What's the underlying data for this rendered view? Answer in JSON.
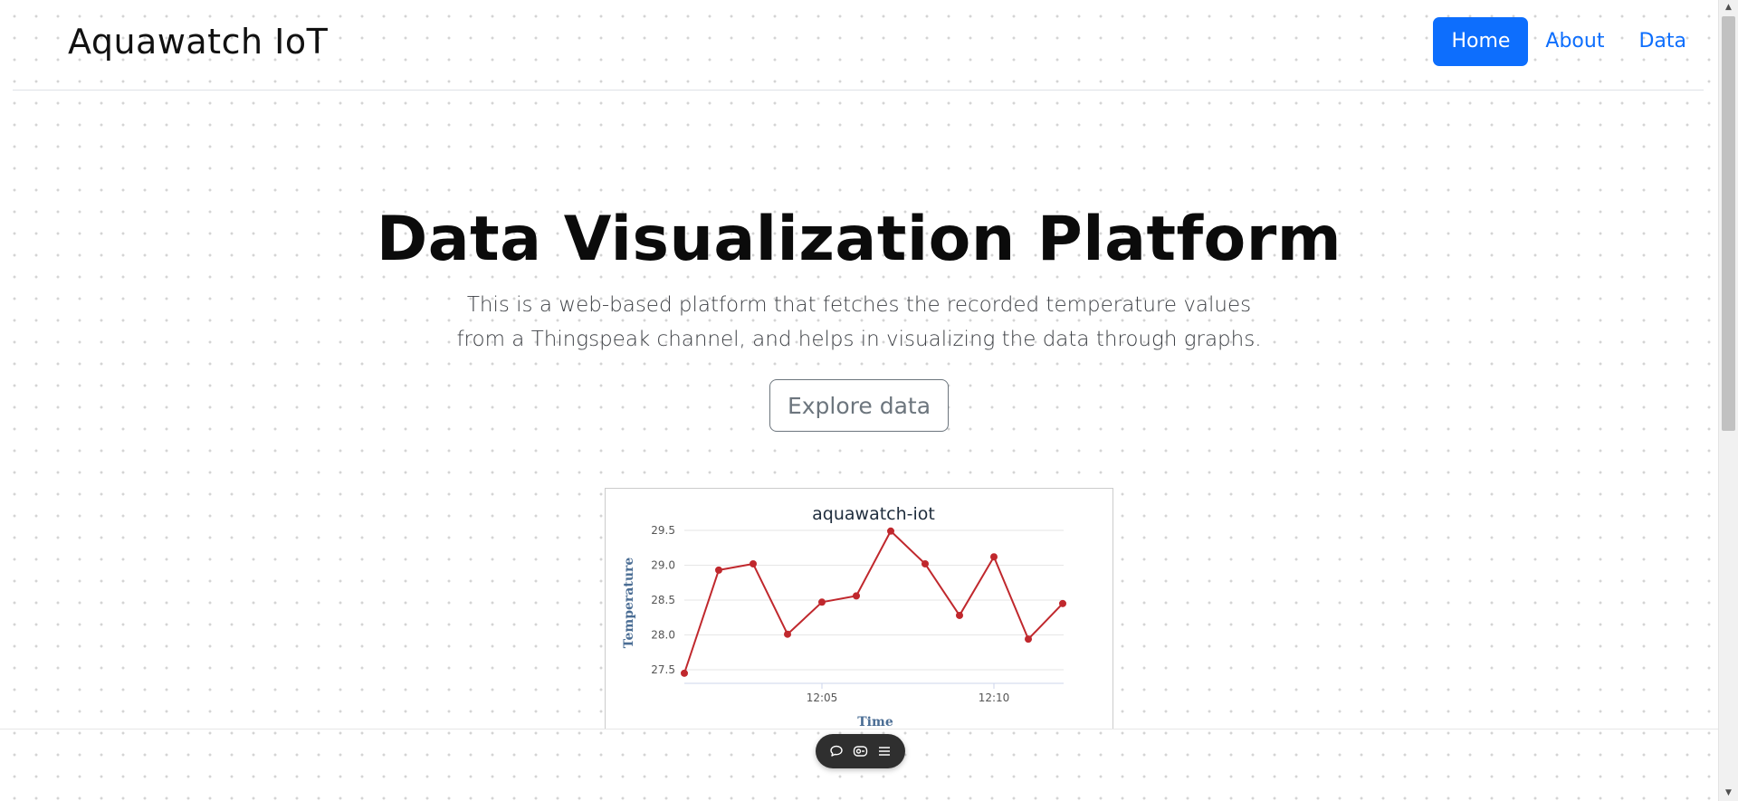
{
  "navbar": {
    "brand": "Aquawatch IoT",
    "links": [
      "Home",
      "About",
      "Data"
    ],
    "active_link": "Home",
    "accent_color": "#0d6efd"
  },
  "hero": {
    "title": "Data Visualization Platform",
    "lead": "This is a web-based platform that fetches the recorded temperature values from a Thingspeak channel, and helps in visualizing the data through graphs.",
    "explore_button": "Explore data"
  },
  "chart_data": {
    "type": "line",
    "title": "aquawatch-iot",
    "xlabel": "Time",
    "ylabel": "Temperature",
    "x": [
      "12:01",
      "12:02",
      "12:03",
      "12:04",
      "12:05",
      "12:06",
      "12:07",
      "12:08",
      "12:09",
      "12:10",
      "12:11",
      "12:12"
    ],
    "y": [
      27.45,
      28.93,
      29.02,
      28.01,
      28.47,
      28.56,
      29.49,
      29.02,
      28.28,
      29.12,
      27.94,
      28.45
    ],
    "x_ticks": [
      "12:05",
      "12:10"
    ],
    "y_ticks": [
      27.5,
      28.0,
      28.5,
      29.0,
      29.5
    ],
    "ylim": [
      27.5,
      29.5
    ],
    "line_color": "#c0282d",
    "grid": true,
    "legend": "none"
  },
  "toolbar": {
    "icons": [
      "comment-icon",
      "caption-icon",
      "menu-icon"
    ]
  }
}
